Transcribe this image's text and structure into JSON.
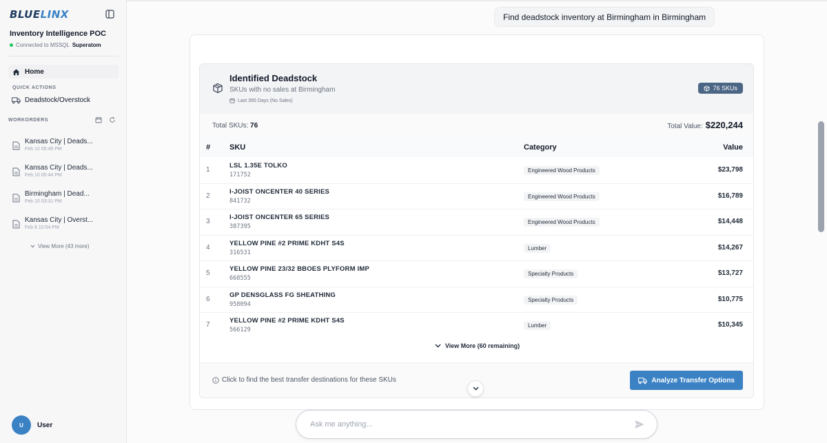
{
  "sidebar": {
    "logo_part1": "BLUE",
    "logo_part2": "LINX",
    "app_title": "Inventory Intelligence POC",
    "connection_prefix": "Connected to MSSQL",
    "connection_name": "Superatom",
    "home_label": "Home",
    "quick_actions_label": "QUICK ACTIONS",
    "quick_action_item": "Deadstock/Overstock",
    "workorders_label": "WORKORDERS",
    "workorders": [
      {
        "title": "Kansas City | Deads...",
        "date": "Feb 10 05:45 PM"
      },
      {
        "title": "Kansas City | Deads...",
        "date": "Feb 10 05:44 PM"
      },
      {
        "title": "Birmingham | Dead...",
        "date": "Feb 10 03:31 PM"
      },
      {
        "title": "Kansas City | Overst...",
        "date": "Feb 8 10:54 PM"
      }
    ],
    "view_more": "View More (43 more)",
    "user_initial": "U",
    "user_name": "User"
  },
  "chat": {
    "user_message": "Find deadstock inventory at Birmingham in Birmingham",
    "input_placeholder": "Ask me anything..."
  },
  "deadstock": {
    "title": "Identified Deadstock",
    "subtitle": "SKUs with no sales at Birmingham",
    "period": "Last 365 Days (No Sales)",
    "badge": "76 SKUs",
    "total_skus_label": "Total SKUs:",
    "total_skus": "76",
    "total_value_label": "Total Value:",
    "total_value": "$220,244",
    "columns": {
      "idx": "#",
      "sku": "SKU",
      "category": "Category",
      "value": "Value"
    },
    "rows": [
      {
        "idx": "1",
        "name": "LSL 1.35E TOLKO",
        "code": "171752",
        "category": "Engineered Wood Products",
        "value": "$23,798"
      },
      {
        "idx": "2",
        "name": "I-JOIST ONCENTER 40 SERIES",
        "code": "841732",
        "category": "Engineered Wood Products",
        "value": "$16,789"
      },
      {
        "idx": "3",
        "name": "I-JOIST ONCENTER 65 SERIES",
        "code": "387395",
        "category": "Engineered Wood Products",
        "value": "$14,448"
      },
      {
        "idx": "4",
        "name": "YELLOW PINE #2 PRIME KDHT S4S",
        "code": "316531",
        "category": "Lumber",
        "value": "$14,267"
      },
      {
        "idx": "5",
        "name": "YELLOW PINE 23/32 BBOES PLYFORM IMP",
        "code": "668555",
        "category": "Specialty Products",
        "value": "$13,727"
      },
      {
        "idx": "6",
        "name": "GP DENSGLASS FG SHEATHING",
        "code": "958094",
        "category": "Specialty Products",
        "value": "$10,775"
      },
      {
        "idx": "7",
        "name": "YELLOW PINE #2 PRIME KDHT S4S",
        "code": "566129",
        "category": "Lumber",
        "value": "$10,345"
      }
    ],
    "view_more": "View More (60 remaining)",
    "hint": "Click to find the best transfer destinations for these SKUs",
    "analyze_button": "Analyze Transfer Options"
  },
  "colors": {
    "accent": "#3b82c4",
    "badge": "#4b6584",
    "connected": "#22c55e"
  }
}
